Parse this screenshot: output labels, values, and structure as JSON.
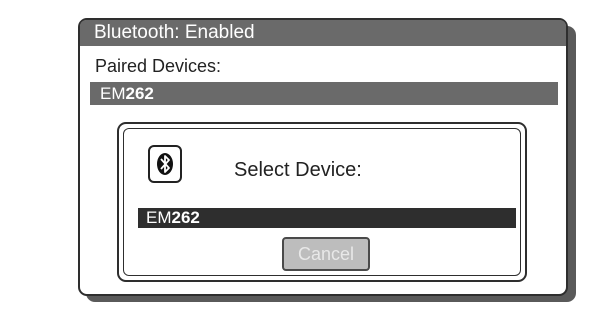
{
  "window": {
    "title": "Bluetooth: Enabled",
    "paired_label": "Paired Devices:",
    "paired_device": {
      "prefix": "EM",
      "number": "262"
    }
  },
  "dialog": {
    "icon": "bluetooth-icon",
    "title": "Select Device:",
    "device": {
      "prefix": "EM",
      "number": "262"
    },
    "cancel_label": "Cancel"
  },
  "colors": {
    "titlebar": "#6a6a6a",
    "selected_row": "#2e2e2e",
    "border": "#2e2e2e"
  }
}
